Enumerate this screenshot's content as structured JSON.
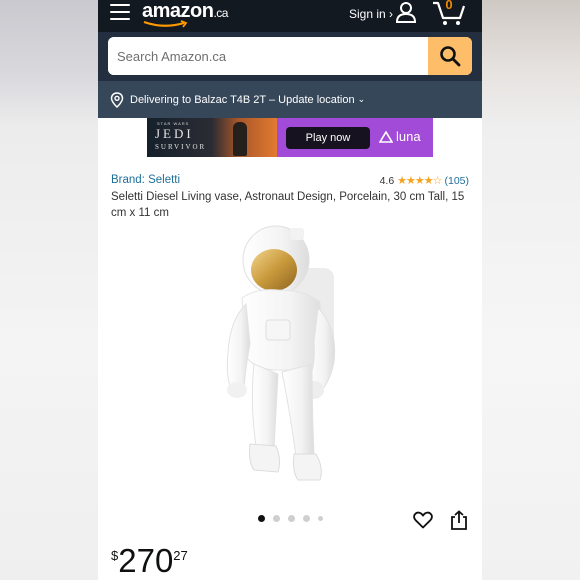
{
  "header": {
    "logo_text": "amazon",
    "logo_tld": ".ca",
    "signin_label": "Sign in ›",
    "cart_count": "0"
  },
  "search": {
    "placeholder": "Search Amazon.ca"
  },
  "location": {
    "text": "Delivering to Balzac T4B 2T – Update location",
    "chevron": "⌄"
  },
  "ad": {
    "brand_small": "STAR WARS",
    "title_line1": "JEDI",
    "title_line2": "SURVIVOR",
    "cta": "Play now",
    "service": "luna"
  },
  "product": {
    "brand": "Brand: Seletti",
    "rating_value": "4.6",
    "stars": "★★★★☆",
    "review_count": "(105)",
    "title": "Seletti Diesel Living vase, Astronaut Design, Porcelain, 30 cm Tall, 15 cm x 11 cm",
    "image_count": 5,
    "active_image": 1,
    "price_currency": "$",
    "price_whole": "270",
    "price_fraction": "27"
  },
  "colors": {
    "topbar": "#131921",
    "searchbar": "#232f3e",
    "location_bar": "#37475a",
    "search_button": "#febd69",
    "link": "#1d6f9a",
    "star": "#f4a41d",
    "ad_bg": "#a24bd8"
  },
  "icons": {
    "menu": "hamburger-icon",
    "account": "user-icon",
    "cart": "cart-icon",
    "search": "search-icon",
    "location": "location-pin-icon",
    "wishlist": "heart-icon",
    "share": "share-icon"
  }
}
